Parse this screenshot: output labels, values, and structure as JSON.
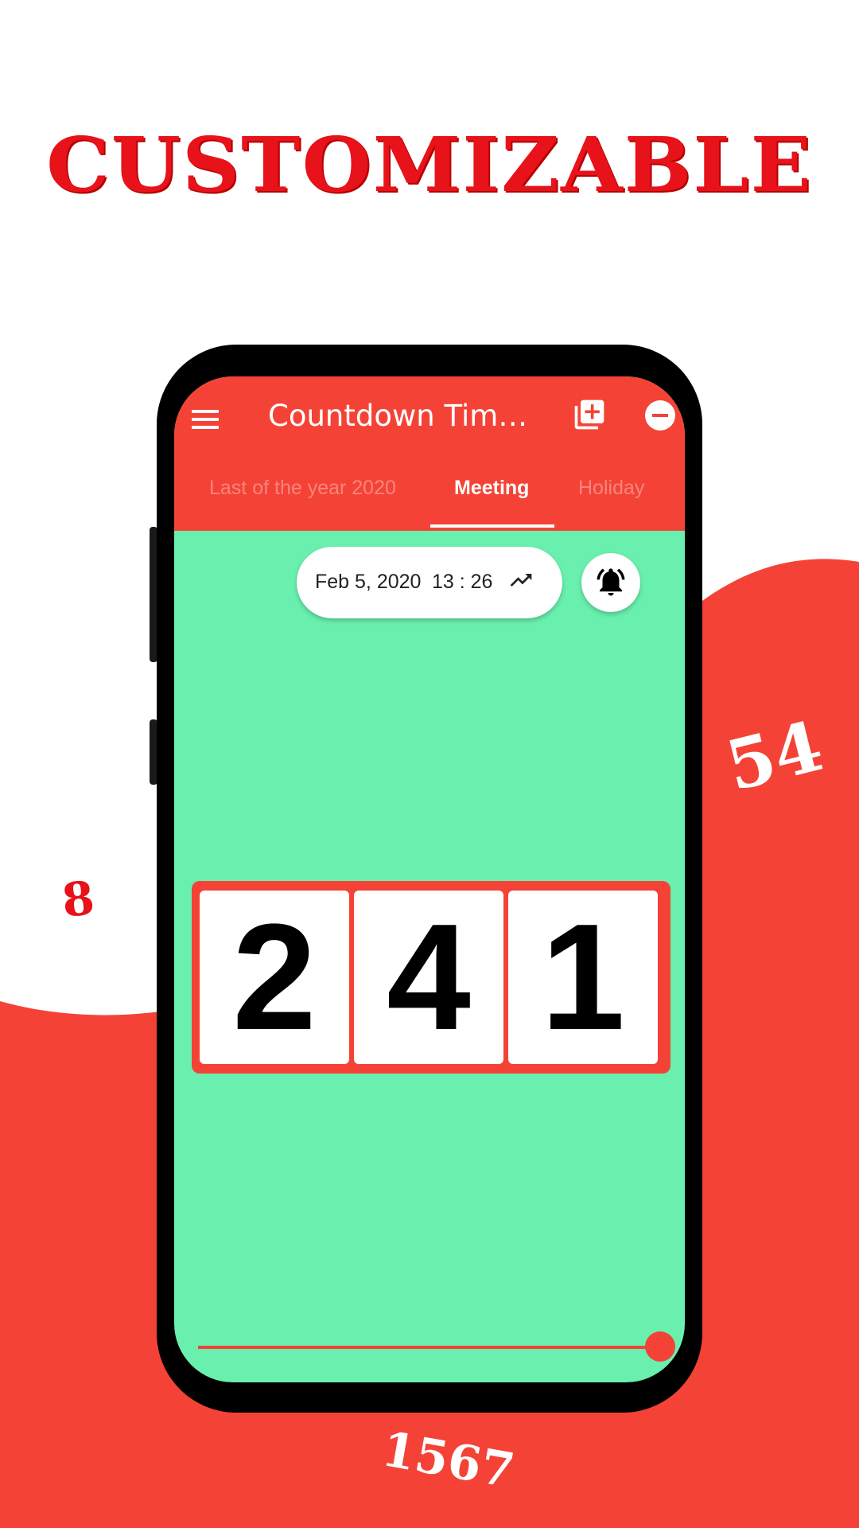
{
  "headline": "CUSTOMIZABLE",
  "decorations": {
    "number_small": "8",
    "number_right": "54",
    "number_bottom": "1567"
  },
  "colors": {
    "accent": "#f44336",
    "screen_bg": "#69f0ae",
    "headline": "#e8121a"
  },
  "appbar": {
    "title": "Countdown Timer…",
    "menu_icon": "menu-icon",
    "add_icon": "library-add-icon",
    "remove_icon": "remove-circle-icon"
  },
  "tabs": [
    {
      "label": "Last of the year 2020",
      "selected": false
    },
    {
      "label": "Meeting",
      "selected": true
    },
    {
      "label": "Holiday",
      "selected": false
    }
  ],
  "target": {
    "date": "Feb 5, 2020",
    "time": "13 : 26",
    "icon": "trending-up-icon"
  },
  "alarm": {
    "icon": "alarm-bell-icon"
  },
  "countdown": {
    "digits": [
      "2",
      "4",
      "1"
    ]
  },
  "progress": {
    "fraction": 1.0
  }
}
